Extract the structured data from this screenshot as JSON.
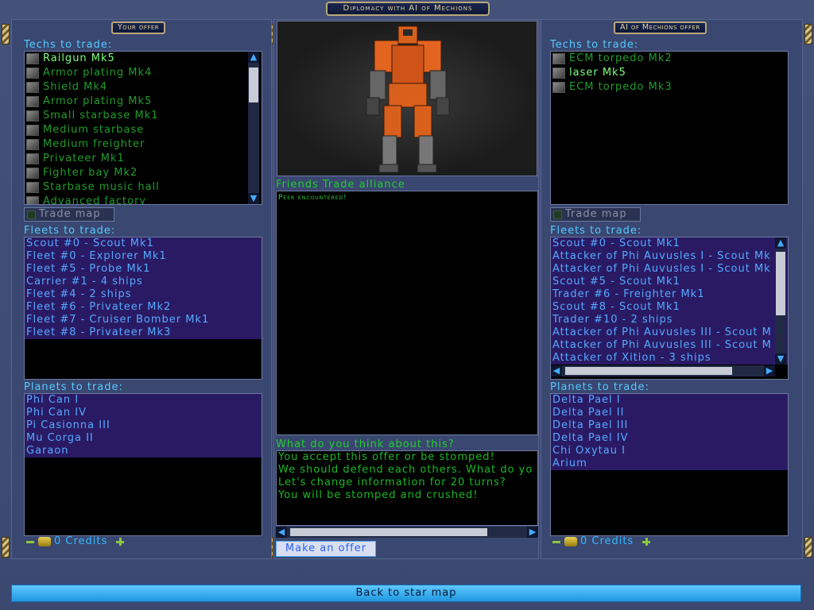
{
  "window": {
    "title": "Diplomacy with AI of Mechions"
  },
  "your_offer": {
    "header": "Your offer",
    "techs_label": "Techs to trade:",
    "techs": [
      {
        "label": "Railgun Mk5",
        "icon": "weapon-icon",
        "selected": true
      },
      {
        "label": "Armor plating Mk4",
        "icon": "armor-icon"
      },
      {
        "label": "Shield Mk4",
        "icon": "shield-icon"
      },
      {
        "label": "Armor plating Mk5",
        "icon": "armor-icon"
      },
      {
        "label": "Small starbase Mk1",
        "icon": "starbase-icon"
      },
      {
        "label": "Medium starbase",
        "icon": "starbase-icon"
      },
      {
        "label": "Medium freighter",
        "icon": "ship-icon"
      },
      {
        "label": "Privateer Mk1",
        "icon": "ship-icon"
      },
      {
        "label": "Fighter bay Mk2",
        "icon": "ship-icon"
      },
      {
        "label": "Starbase music hall",
        "icon": "starbase-icon"
      },
      {
        "label": "Advanced factory",
        "icon": "factory-icon"
      }
    ],
    "trade_map": "Trade map",
    "fleets_label": "Fleets to trade:",
    "fleets": [
      "Scout #0 - Scout Mk1",
      "Fleet #0 - Explorer Mk1",
      "Fleet #5 - Probe Mk1",
      "Carrier #1 - 4 ships",
      "Fleet #4 - 2 ships",
      "Fleet #6 - Privateer Mk2",
      "Fleet #7 - Cruiser Bomber Mk1",
      "Fleet #8 - Privateer Mk3"
    ],
    "planets_label": "Planets to trade:",
    "planets": [
      "Phi Can I",
      "Phi Can IV",
      "Pi Casionna III",
      "Mu Corga II",
      "Garaon"
    ],
    "credits": "0 Credits"
  },
  "ai_offer": {
    "header": "AI of Mechions offer",
    "techs_label": "Techs to trade:",
    "techs": [
      {
        "label": "ECM torpedo Mk2",
        "icon": "torpedo-icon"
      },
      {
        "label": "laser Mk5",
        "icon": "weapon-icon",
        "selected": true
      },
      {
        "label": "ECM torpedo Mk3",
        "icon": "torpedo-icon"
      }
    ],
    "trade_map": "Trade map",
    "fleets_label": "Fleets to trade:",
    "fleets": [
      "Scout #0 - Scout Mk1",
      "Attacker of Phi Auvusles I - Scout Mk",
      "Attacker of Phi Auvusles I - Scout Mk",
      "Scout #5 - Scout Mk1",
      "Trader #6 - Freighter Mk1",
      "Scout #8 - Scout Mk1",
      "Trader #10 - 2 ships",
      "Attacker of Phi Auvusles III - Scout M",
      "Attacker of Phi Auvusles III - Scout M",
      "Attacker of Xition - 3 ships"
    ],
    "planets_label": "Planets to trade:",
    "planets": [
      "Delta Pael I",
      "Delta Pael II",
      "Delta Pael III",
      "Delta Pael IV",
      "Chi Oxytau I",
      "Arium"
    ],
    "credits": "0 Credits"
  },
  "center": {
    "relation_status": "Friends Trade alliance",
    "log": [
      "Peer encountered!"
    ],
    "question": "What do you think about this?",
    "replies": [
      "You accept this offer or be stomped!",
      "We should defend each others. What do yo",
      "Let's change information for 20 turns?",
      "You will be stomped and crushed!"
    ],
    "make_offer": "Make an offer"
  },
  "footer": {
    "back": "Back to star map"
  },
  "colors": {
    "frame": "#3a4770",
    "list_bg": "#000000",
    "tech_text": "#1f9e2a",
    "fleet_text": "#55aaff",
    "fleet_row_bg": "#2a1a64",
    "label_cyan": "#55c9ff",
    "accent_green": "#1fd12a",
    "gold": "#e8d29a"
  }
}
